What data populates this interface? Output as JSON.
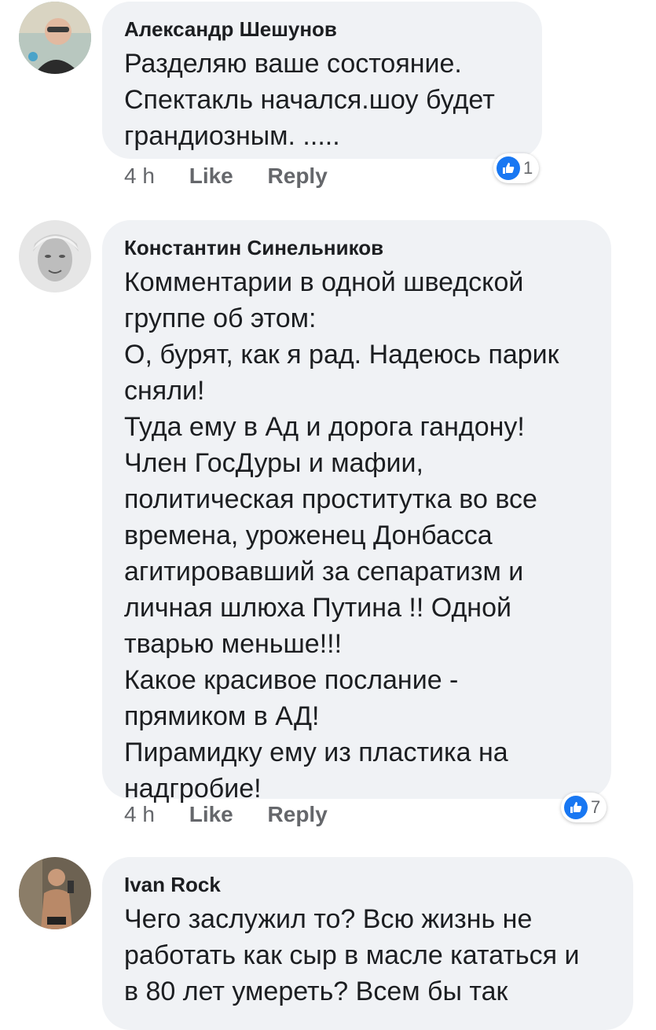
{
  "comments": [
    {
      "author": "Александр Шешунов",
      "text": "Разделяю ваше состояние.\nСпектакль начался.шоу будет\nграндиозным. .....",
      "time": "4 h",
      "like_label": "Like",
      "reply_label": "Reply",
      "reactions": "1"
    },
    {
      "author": "Константин Синельников",
      "text": "Комментарии в одной шведской\nгруппе об этом:\nО, бурят, как я рад. Надеюсь парик\nсняли!\nТуда ему в Ад и дорога гандону!\nЧлен ГосДуры и мафии,\nполитическая проститутка во все\nвремена, уроженец Донбасса\nагитировавший за сепаратизм и\nличная шлюха Путина !! Одной\nтварью меньше!!!\nКакое красивое послание -\nпрямиком в АД!\nПирамидку ему из пластика на\nнадгробие!",
      "time": "4 h",
      "like_label": "Like",
      "reply_label": "Reply",
      "reactions": "7"
    },
    {
      "author": "Ivan Rock",
      "text": "Чего заслужил то? Всю жизнь не\nработать как сыр в масле кататься и\nв 80 лет умереть? Всем бы так"
    }
  ],
  "colors": {
    "bubble": "#f0f2f5",
    "like_blue": "#1877f2",
    "meta_grey": "#65676b"
  }
}
